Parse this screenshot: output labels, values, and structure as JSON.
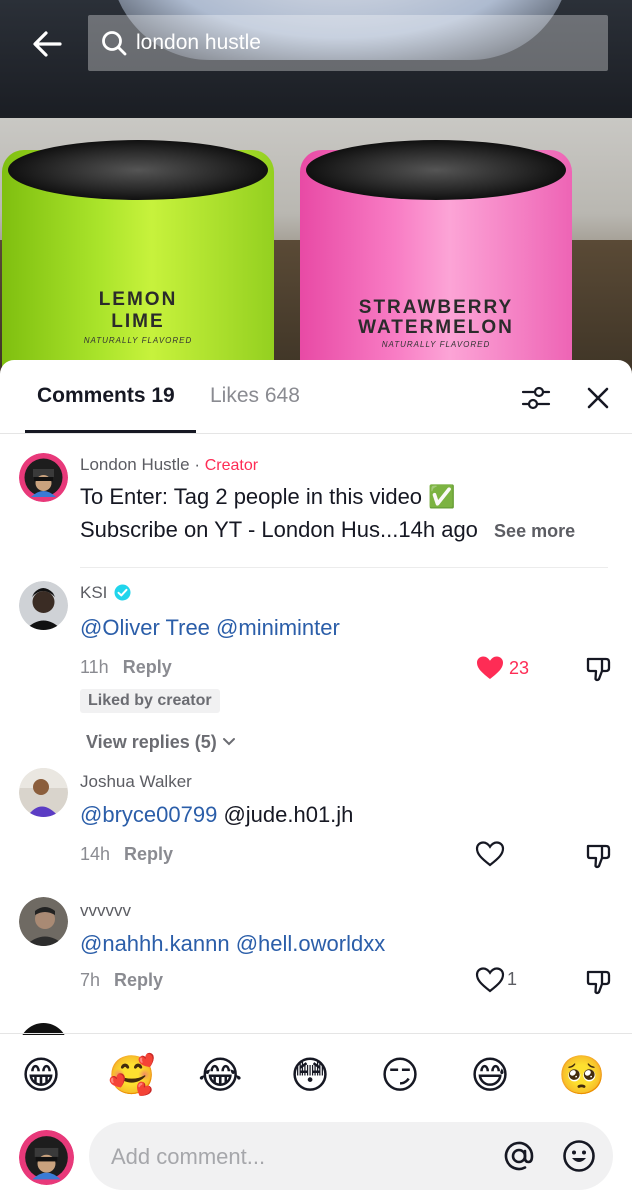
{
  "search": {
    "query": "london hustle"
  },
  "video": {
    "can_left": {
      "line1": "LEMON",
      "line2": "LIME",
      "sub": "NATURALLY FLAVORED"
    },
    "can_right": {
      "line1": "STRAWBERRY",
      "line2": "WATERMELON",
      "sub": "NATURALLY FLAVORED"
    }
  },
  "tabs": {
    "comments": "Comments 19",
    "likes": "Likes 648"
  },
  "comments": [
    {
      "username": "London Hustle",
      "separator": " · ",
      "creator_tag": "Creator",
      "line1": "To Enter: Tag 2 people in this video ✅",
      "line2": "Subscribe on YT - London Hus...",
      "time": "14h ago",
      "see_more": "See more"
    },
    {
      "username": "KSI",
      "mention1": "@Oliver Tree",
      "mention2": "@miniminter",
      "time": "11h",
      "reply": "Reply",
      "likes": "23",
      "liked_by": "Liked by creator",
      "view_replies": "View replies (5)"
    },
    {
      "username": "Joshua Walker",
      "mention1": "@bryce00799",
      "plain": "@jude.h01.jh",
      "time": "14h",
      "reply": "Reply"
    },
    {
      "username": "vvvvvv",
      "mention1": "@nahhh.kannn",
      "mention2": "@hell.oworldxx",
      "time": "7h",
      "reply": "Reply",
      "likes": "1"
    }
  ],
  "emojis": [
    "😁",
    "🥰",
    "😂",
    "😳",
    "😏",
    "😅",
    "🥺"
  ],
  "input": {
    "placeholder": "Add comment..."
  },
  "colors": {
    "accent": "#fe2c55",
    "mention": "#2b5ea9",
    "verified": "#20d5ec"
  }
}
